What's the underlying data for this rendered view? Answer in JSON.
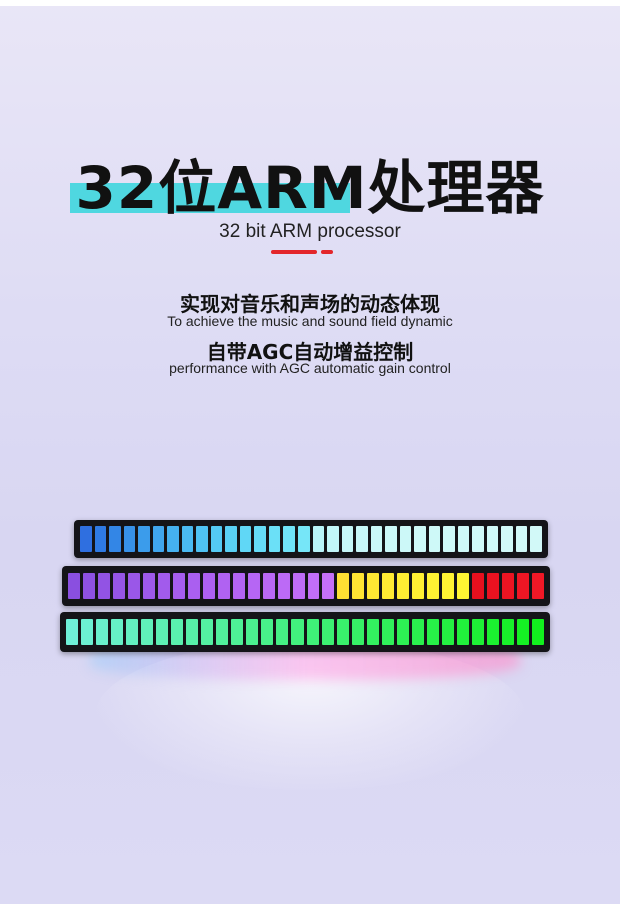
{
  "title": "32位ARM处理器",
  "subtitle": "32 bit ARM processor",
  "features": [
    {
      "cn": "实现对音乐和声场的动态体现",
      "en": "To achieve the music and sound field dynamic"
    },
    {
      "cn": "自带AGC自动增益控制",
      "en": "performance with AGC automatic gain control"
    }
  ],
  "colors": {
    "title_highlight": "#4fd7e0",
    "accent_red": "#e3262b"
  },
  "light_bars": [
    {
      "name": "blue-cyan-bar",
      "segments": 32,
      "colors": [
        "#2f6fe0",
        "#2f7ae3",
        "#3386e6",
        "#3791e8",
        "#3b9ceb",
        "#40a6ee",
        "#45b1f0",
        "#4abaf2",
        "#4fc2f3",
        "#54caf4",
        "#5ad1f5",
        "#60d7f6",
        "#66dcf7",
        "#6be0f7",
        "#70e3f8",
        "#76e6f8",
        "#b9f4f8",
        "#c2f6f8",
        "#c6f7f8",
        "#c8f7f8",
        "#caf8f8",
        "#cbf8f8",
        "#ccf8f8",
        "#cdf9f8",
        "#cef9f8",
        "#cff9f8",
        "#cff9f8",
        "#d0f9f8",
        "#d0f9f8",
        "#d1f9f8",
        "#d1f9f8",
        "#d2f9f8"
      ]
    },
    {
      "name": "purple-yellow-red-bar",
      "segments": 32,
      "colors": [
        "#8a4fe0",
        "#8e51e2",
        "#9253e4",
        "#9655e6",
        "#9a57e8",
        "#9e59ea",
        "#a25bec",
        "#a65dee",
        "#aa5ff0",
        "#ad60f1",
        "#b062f2",
        "#b364f3",
        "#b666f4",
        "#b968f5",
        "#bc6af6",
        "#bf6cf7",
        "#c26ef8",
        "#c570f8",
        "#ffe033",
        "#ffe533",
        "#ffe833",
        "#ffeb33",
        "#ffee33",
        "#fff033",
        "#fff233",
        "#fff433",
        "#fff533",
        "#e8101e",
        "#ea1220",
        "#ec1422",
        "#ee1624",
        "#f01826"
      ]
    },
    {
      "name": "cyan-green-bar",
      "segments": 32,
      "colors": [
        "#6ff0d8",
        "#6cf0d2",
        "#69f0cc",
        "#66f0c6",
        "#63f0c0",
        "#60f0ba",
        "#5df0b4",
        "#5af0ae",
        "#57f0a8",
        "#54f0a2",
        "#51f09c",
        "#4ef096",
        "#4bf090",
        "#48f08a",
        "#45f084",
        "#42f07e",
        "#3ff078",
        "#3cf072",
        "#39f06c",
        "#36f066",
        "#33f060",
        "#30f05a",
        "#2df054",
        "#2af04e",
        "#27f048",
        "#24f042",
        "#21f03c",
        "#1ef036",
        "#1bf030",
        "#18f02a",
        "#15f024",
        "#12f01e"
      ]
    }
  ]
}
